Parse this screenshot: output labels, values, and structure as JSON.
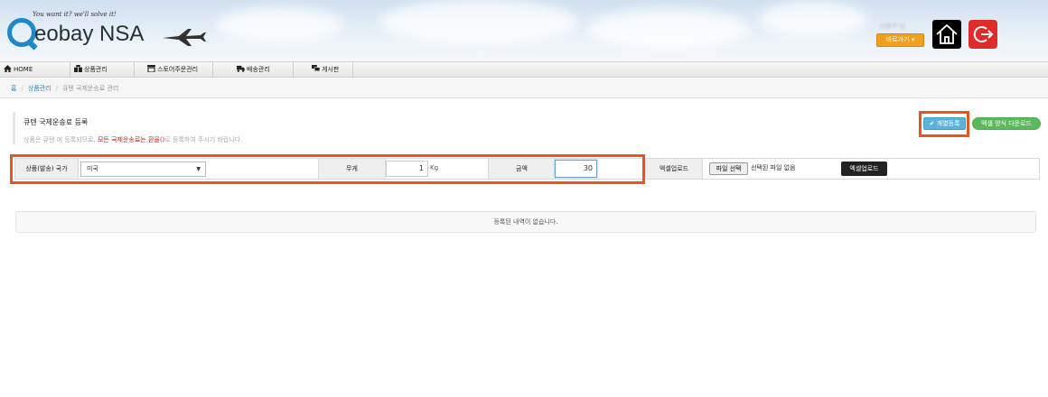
{
  "header": {
    "tagline": "You want it? we'll solve it!",
    "logo_text": "eobay NSA",
    "user_name": "사용자 님",
    "dropdown_label": "바로가기 ▾"
  },
  "nav": {
    "items": [
      {
        "label": "HOME",
        "icon": "home-icon"
      },
      {
        "label": "상품관리",
        "icon": "boxes-icon"
      },
      {
        "label": "스토어주문관리",
        "icon": "store-icon"
      },
      {
        "label": "배송관리",
        "icon": "truck-icon"
      },
      {
        "label": "게시판",
        "icon": "chat-icon"
      }
    ]
  },
  "breadcrumb": {
    "home": "홈",
    "level1": "상품관리",
    "current": "큐텐 국제운송료 관리"
  },
  "page": {
    "title": "큐텐 국제운송료 등록",
    "notice_prefix": "상품은 큐텐 에 등록되므로, ",
    "notice_warning": "모든 국제운송료는 환율()",
    "notice_suffix": "로 등록하여 주시기 바랍니다.",
    "register_button": "✔ 개별등록",
    "excel_download_button": "엑셀 양식 다운로드"
  },
  "form": {
    "country_label": "상품(발송) 국가",
    "country_value": "미국",
    "weight_label": "무게",
    "weight_value": "1",
    "weight_unit": "Kg",
    "amount_label": "금액",
    "amount_value": "30",
    "excel_upload_label": "엑셀업로드",
    "file_button": "파일 선택",
    "file_status": "선택된 파일 없음",
    "excel_upload_button": "엑셀업로드"
  },
  "list": {
    "empty_message": "등록된 내역이 없습니다."
  },
  "colors": {
    "highlight": "#e8561b",
    "register_button": "#5bb3d8",
    "excel_download_button": "#5cb85c",
    "logout_button": "#e02b2b",
    "dropdown_button": "#f0a020"
  }
}
